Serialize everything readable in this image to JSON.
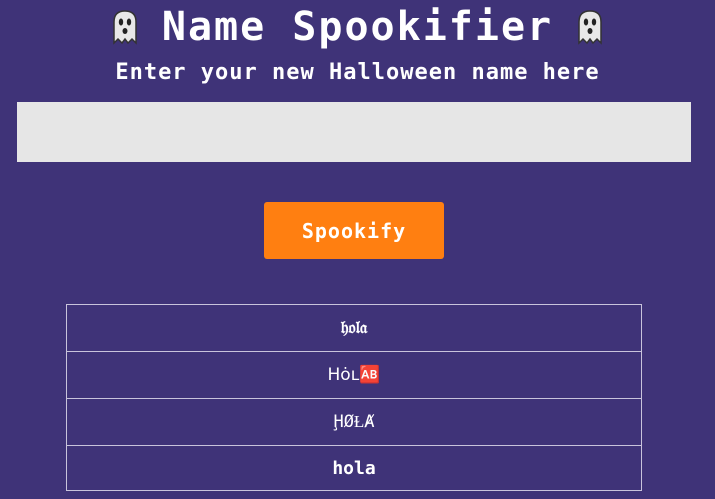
{
  "header": {
    "title": "Name Spookifier",
    "left_icon": "ghost-icon",
    "right_icon": "ghost-icon"
  },
  "subtitle": "Enter your new Halloween name here",
  "input": {
    "value": "",
    "placeholder": ""
  },
  "button": {
    "label": "Spookify"
  },
  "results": [
    "𝔥𝔬𝔩𝔞",
    "Hȯʟ🆎",
    "ḨØⱢȺ",
    "hola"
  ],
  "colors": {
    "background": "#3f3378",
    "button": "#ff7f11",
    "input_bg": "#e6e6e6",
    "table_border": "#c9c4dc"
  }
}
